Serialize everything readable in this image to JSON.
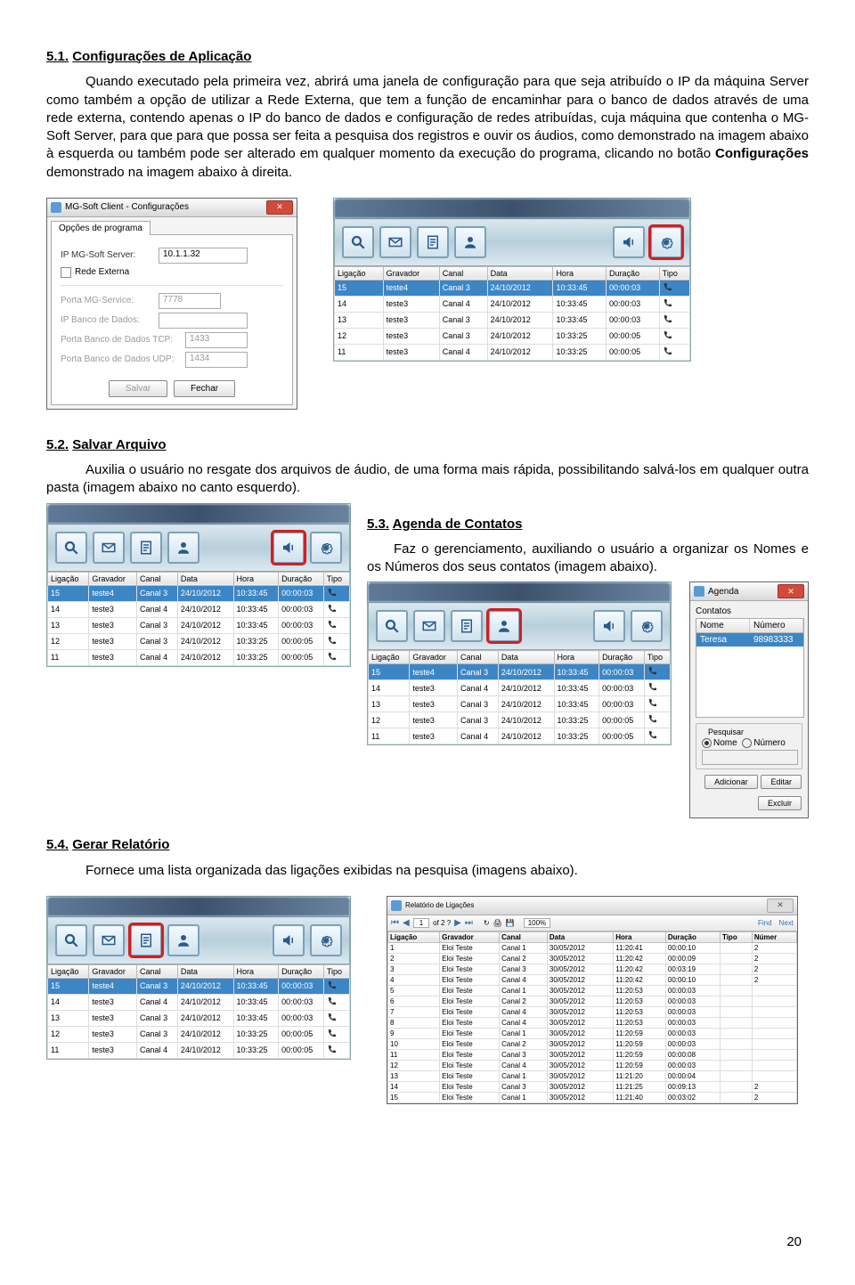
{
  "page_number": "20",
  "sections": {
    "s51": {
      "num": "5.1.",
      "title": "Configurações de Aplicação",
      "p1": "Quando executado pela primeira vez, abrirá uma janela de configuração para que seja atribuído o IP da máquina Server como também a opção de utilizar a Rede Externa, que tem a função de encaminhar para o banco de dados através de uma rede externa, contendo apenas o IP do banco de dados e configuração de redes atribuídas, cuja máquina que contenha o MG-Soft Server, para que para que possa ser feita a pesquisa dos registros e ouvir os áudios, como demonstrado na imagem abaixo à esquerda ou também pode ser alterado em qualquer momento da execução do programa, clicando no botão ",
      "p1b": "Configurações",
      "p1c": " demonstrado na imagem abaixo à direita."
    },
    "s52": {
      "num": "5.2.",
      "title": "Salvar Arquivo",
      "p1": "Auxilia o usuário no resgate dos arquivos de áudio, de uma forma mais rápida, possibilitando salvá-los em qualquer outra pasta (imagem abaixo no canto esquerdo)."
    },
    "s53": {
      "num": "5.3.",
      "title": "Agenda de Contatos",
      "p1": "Faz o gerenciamento, auxiliando o usuário a organizar os Nomes e os Números dos seus contatos (imagem abaixo)."
    },
    "s54": {
      "num": "5.4.",
      "title": "Gerar Relatório",
      "p1": "Fornece uma lista organizada das ligações exibidas na pesquisa (imagens abaixo)."
    }
  },
  "config_win": {
    "title": "MG-Soft Client - Configurações",
    "tab": "Opções de programa",
    "ip_label": "IP MG-Soft Server:",
    "ip_val": "10.1.1.32",
    "ext_label": "Rede Externa",
    "porta_svc": "Porta MG-Service:",
    "porta_svc_val": "7778",
    "ip_bd": "IP Banco de Dados:",
    "tcp": "Porta Banco de Dados TCP:",
    "tcp_val": "1433",
    "udp": "Porta Banco de Dados UDP:",
    "udp_val": "1434",
    "save": "Salvar",
    "close": "Fechar"
  },
  "table": {
    "headers": [
      "Ligação",
      "Gravador",
      "Canal",
      "Data",
      "Hora",
      "Duração",
      "Tipo"
    ],
    "rows": [
      [
        "15",
        "teste4",
        "Canal 3",
        "24/10/2012",
        "10:33:45",
        "00:00:03"
      ],
      [
        "14",
        "teste3",
        "Canal 4",
        "24/10/2012",
        "10:33:45",
        "00:00:03"
      ],
      [
        "13",
        "teste3",
        "Canal 3",
        "24/10/2012",
        "10:33:45",
        "00:00:03"
      ],
      [
        "12",
        "teste3",
        "Canal 3",
        "24/10/2012",
        "10:33:25",
        "00:00:05"
      ],
      [
        "11",
        "teste3",
        "Canal 4",
        "24/10/2012",
        "10:33:25",
        "00:00:05"
      ]
    ]
  },
  "agenda": {
    "title": "Agenda",
    "tab": "Contatos",
    "col1": "Nome",
    "col2": "Número",
    "row_name": "Teresa",
    "row_num": "98983333",
    "pesq": "Pesquisar",
    "r1": "Nome",
    "r2": "Número",
    "b1": "Adicionar",
    "b2": "Editar",
    "b3": "Excluir"
  },
  "report": {
    "title": "Relatório de Ligações",
    "nav": "of 2 ?",
    "zoom": "100%",
    "find": "Find",
    "next": "Next",
    "headers": [
      "Ligação",
      "Gravador",
      "Canal",
      "Data",
      "Hora",
      "Duração",
      "Tipo",
      "Númer"
    ],
    "rows": [
      [
        "1",
        "Eloi Teste",
        "Canal 1",
        "30/05/2012",
        "11:20:41",
        "00:00:10",
        "",
        "2"
      ],
      [
        "2",
        "Eloi Teste",
        "Canal 2",
        "30/05/2012",
        "11:20:42",
        "00:00:09",
        "",
        "2"
      ],
      [
        "3",
        "Eloi Teste",
        "Canal 3",
        "30/05/2012",
        "11:20:42",
        "00:03:19",
        "",
        "2"
      ],
      [
        "4",
        "Eloi Teste",
        "Canal 4",
        "30/05/2012",
        "11:20:42",
        "00:00:10",
        "",
        "2"
      ],
      [
        "5",
        "Eloi Teste",
        "Canal 1",
        "30/05/2012",
        "11:20:53",
        "00:00:03",
        "",
        ""
      ],
      [
        "6",
        "Eloi Teste",
        "Canal 2",
        "30/05/2012",
        "11:20:53",
        "00:00:03",
        "",
        ""
      ],
      [
        "7",
        "Eloi Teste",
        "Canal 4",
        "30/05/2012",
        "11:20:53",
        "00:00:03",
        "",
        ""
      ],
      [
        "8",
        "Eloi Teste",
        "Canal 4",
        "30/05/2012",
        "11:20:53",
        "00:00:03",
        "",
        ""
      ],
      [
        "9",
        "Eloi Teste",
        "Canal 1",
        "30/05/2012",
        "11:20:59",
        "00:00:03",
        "",
        ""
      ],
      [
        "10",
        "Eloi Teste",
        "Canal 2",
        "30/05/2012",
        "11:20:59",
        "00:00:03",
        "",
        ""
      ],
      [
        "11",
        "Eloi Teste",
        "Canal 3",
        "30/05/2012",
        "11:20:59",
        "00:00:08",
        "",
        ""
      ],
      [
        "12",
        "Eloi Teste",
        "Canal 4",
        "30/05/2012",
        "11:20:59",
        "00:00:03",
        "",
        ""
      ],
      [
        "13",
        "Eloi Teste",
        "Canal 1",
        "30/05/2012",
        "11:21:20",
        "00:00:04",
        "",
        ""
      ],
      [
        "14",
        "Eloi Teste",
        "Canal 3",
        "30/05/2012",
        "11:21:25",
        "00:09:13",
        "",
        "2"
      ],
      [
        "15",
        "Eloi Teste",
        "Canal 1",
        "30/05/2012",
        "11:21:40",
        "00:03:02",
        "",
        "2"
      ]
    ]
  }
}
